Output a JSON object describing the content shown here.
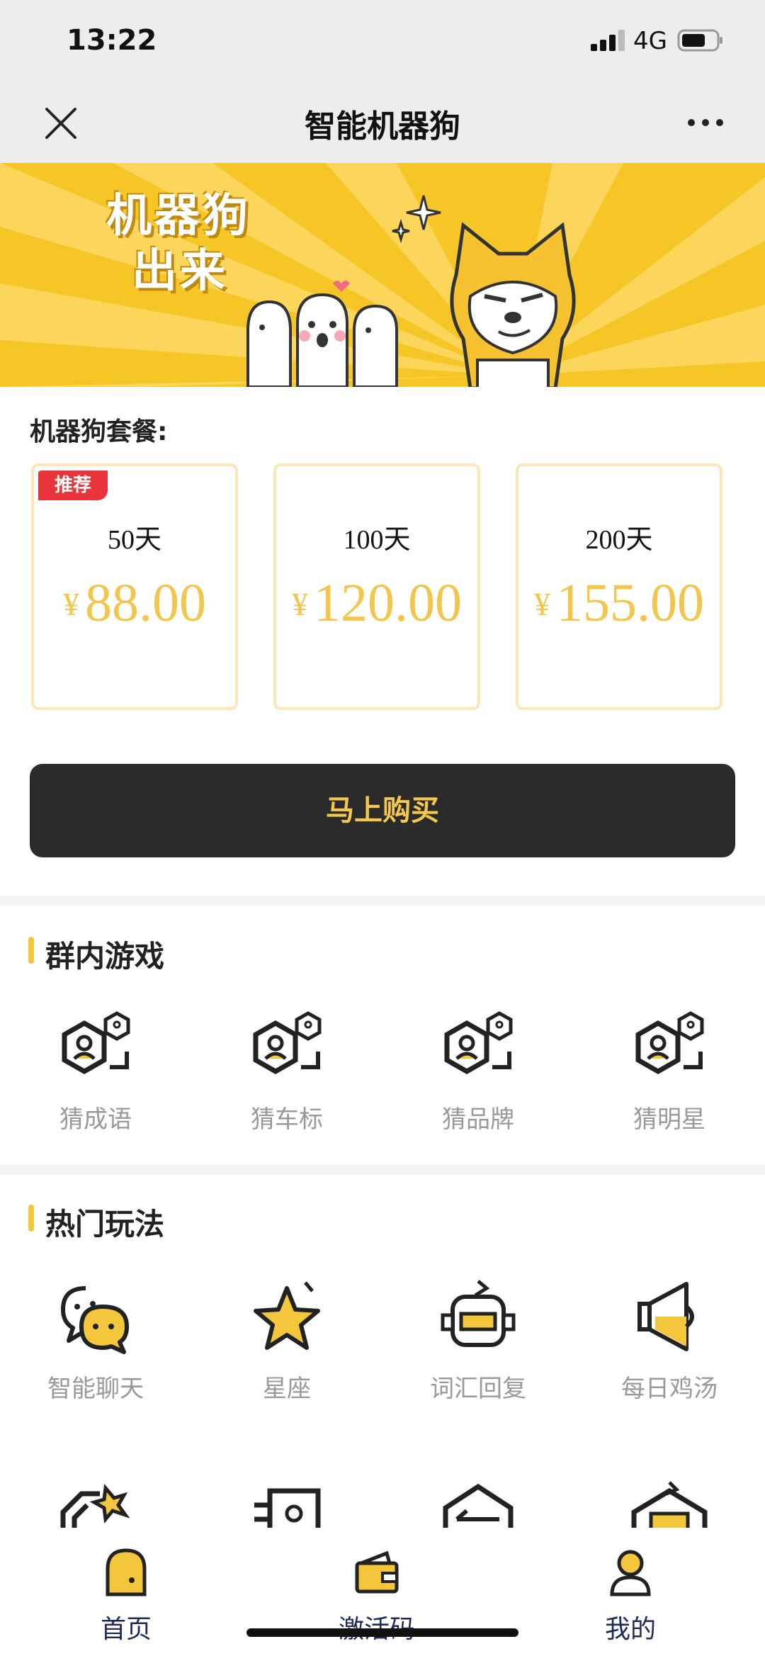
{
  "status_bar": {
    "time": "13:22",
    "network": "4G"
  },
  "nav": {
    "title": "智能机器狗"
  },
  "banner": {
    "line1": "机器狗",
    "line2": "出来"
  },
  "packages": {
    "label": "机器狗套餐:",
    "items": [
      {
        "days": "50天",
        "currency": "¥",
        "price": "88.00",
        "badge": "推荐"
      },
      {
        "days": "100天",
        "currency": "¥",
        "price": "120.00",
        "badge": ""
      },
      {
        "days": "200天",
        "currency": "¥",
        "price": "155.00",
        "badge": ""
      }
    ]
  },
  "buy_button": "马上购买",
  "group_games": {
    "title": "群内游戏",
    "items": [
      {
        "label": "猜成语",
        "icon": "guess-icon"
      },
      {
        "label": "猜车标",
        "icon": "guess-icon"
      },
      {
        "label": "猜品牌",
        "icon": "guess-icon"
      },
      {
        "label": "猜明星",
        "icon": "guess-icon"
      }
    ]
  },
  "hot_features": {
    "title": "热门玩法",
    "items": [
      {
        "label": "智能聊天",
        "icon": "chat-icon"
      },
      {
        "label": "星座",
        "icon": "star-icon"
      },
      {
        "label": "词汇回复",
        "icon": "robot-icon"
      },
      {
        "label": "每日鸡汤",
        "icon": "speaker-icon"
      }
    ]
  },
  "tab_bar": {
    "items": [
      {
        "label": "首页",
        "icon": "home-icon"
      },
      {
        "label": "激活码",
        "icon": "wallet-icon"
      },
      {
        "label": "我的",
        "icon": "profile-icon"
      }
    ]
  },
  "colors": {
    "accent": "#f3c63c",
    "price": "#f3c54a",
    "badge": "#e8343a",
    "button": "#2b2b2b",
    "tab_text": "#1f2a5a"
  }
}
